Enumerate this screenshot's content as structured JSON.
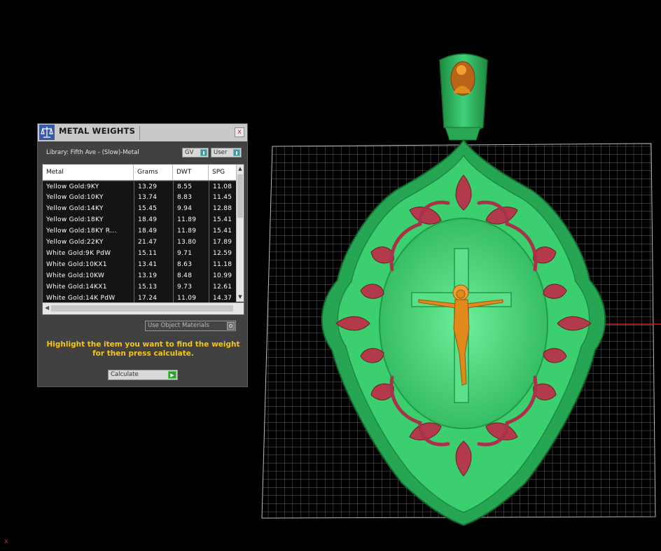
{
  "panel": {
    "title": "METAL WEIGHTS",
    "close_label": "x",
    "library_label": "Library: Fifth Ave - (Slow)-Metal",
    "toggle_gv": "GV",
    "toggle_user": "User",
    "columns": [
      "Metal",
      "Grams",
      "DWT",
      "SPG"
    ],
    "rows": [
      [
        "Yellow Gold:9KY",
        "13.29",
        "8.55",
        "11.08"
      ],
      [
        "Yellow Gold:10KY",
        "13.74",
        "8.83",
        "11.45"
      ],
      [
        "Yellow Gold:14KY",
        "15.45",
        "9.94",
        "12.88"
      ],
      [
        "Yellow Gold:18KY",
        "18.49",
        "11.89",
        "15.41"
      ],
      [
        "Yellow Gold:18KY R...",
        "18.49",
        "11.89",
        "15.41"
      ],
      [
        "Yellow Gold:22KY",
        "21.47",
        "13.80",
        "17.89"
      ],
      [
        "White Gold:9K PdW",
        "15.11",
        "9.71",
        "12.59"
      ],
      [
        "White Gold:10KX1",
        "13.41",
        "8.63",
        "11.18"
      ],
      [
        "White Gold:10KW",
        "13.19",
        "8.48",
        "10.99"
      ],
      [
        "White Gold:14KX1",
        "15.13",
        "9.73",
        "12.61"
      ],
      [
        "White Gold:14K PdW",
        "17.24",
        "11.09",
        "14.37"
      ]
    ],
    "use_object_materials": "Use Object Materials",
    "instruction": "Highlight the item you want to find the weight for then press calculate.",
    "calculate_label": "Calculate"
  },
  "viewport": {
    "axis_label": "x",
    "colors": {
      "pendant_green": "#2fc36a",
      "ornament_red": "#b33a4a",
      "figure_gold": "#e08a1c",
      "grid": "#8a8a8a"
    }
  }
}
